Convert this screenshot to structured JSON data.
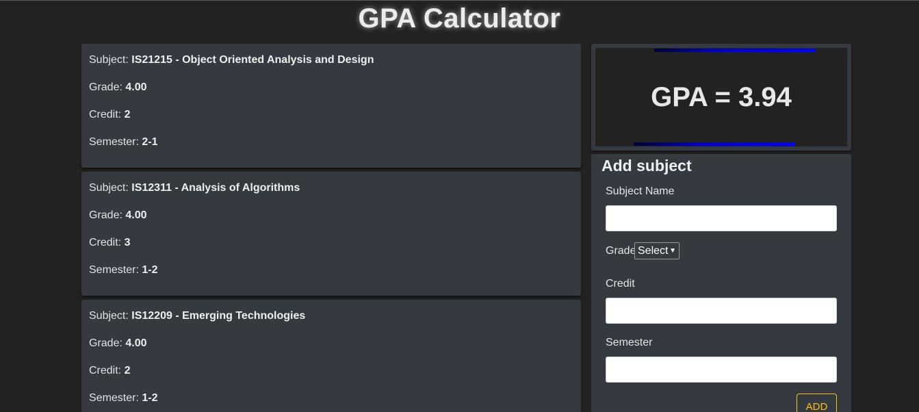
{
  "header": {
    "title": "GPA Calculator"
  },
  "labels": {
    "subject": "Subject:",
    "grade": "Grade:",
    "credit": "Credit:",
    "semester": "Semester:"
  },
  "subjects": [
    {
      "subject": "IS21215 - Object Oriented Analysis and Design",
      "grade": "4.00",
      "credit": "2",
      "semester": "2-1"
    },
    {
      "subject": "IS12311 - Analysis of Algorithms",
      "grade": "4.00",
      "credit": "3",
      "semester": "1-2"
    },
    {
      "subject": "IS12209 - Emerging Technologies",
      "grade": "4.00",
      "credit": "2",
      "semester": "1-2"
    }
  ],
  "gpa": {
    "text": "GPA = 3.94",
    "bar_color": "#0000ff"
  },
  "form": {
    "title": "Add subject",
    "subject_name_label": "Subject Name",
    "subject_name_value": "",
    "grade_label": "Grade",
    "grade_selected": "Select",
    "credit_label": "Credit",
    "credit_value": "",
    "semester_label": "Semester",
    "semester_value": "",
    "add_label": "ADD"
  },
  "colors": {
    "background": "#222222",
    "card": "#343a40",
    "accent": "#ffc107"
  }
}
